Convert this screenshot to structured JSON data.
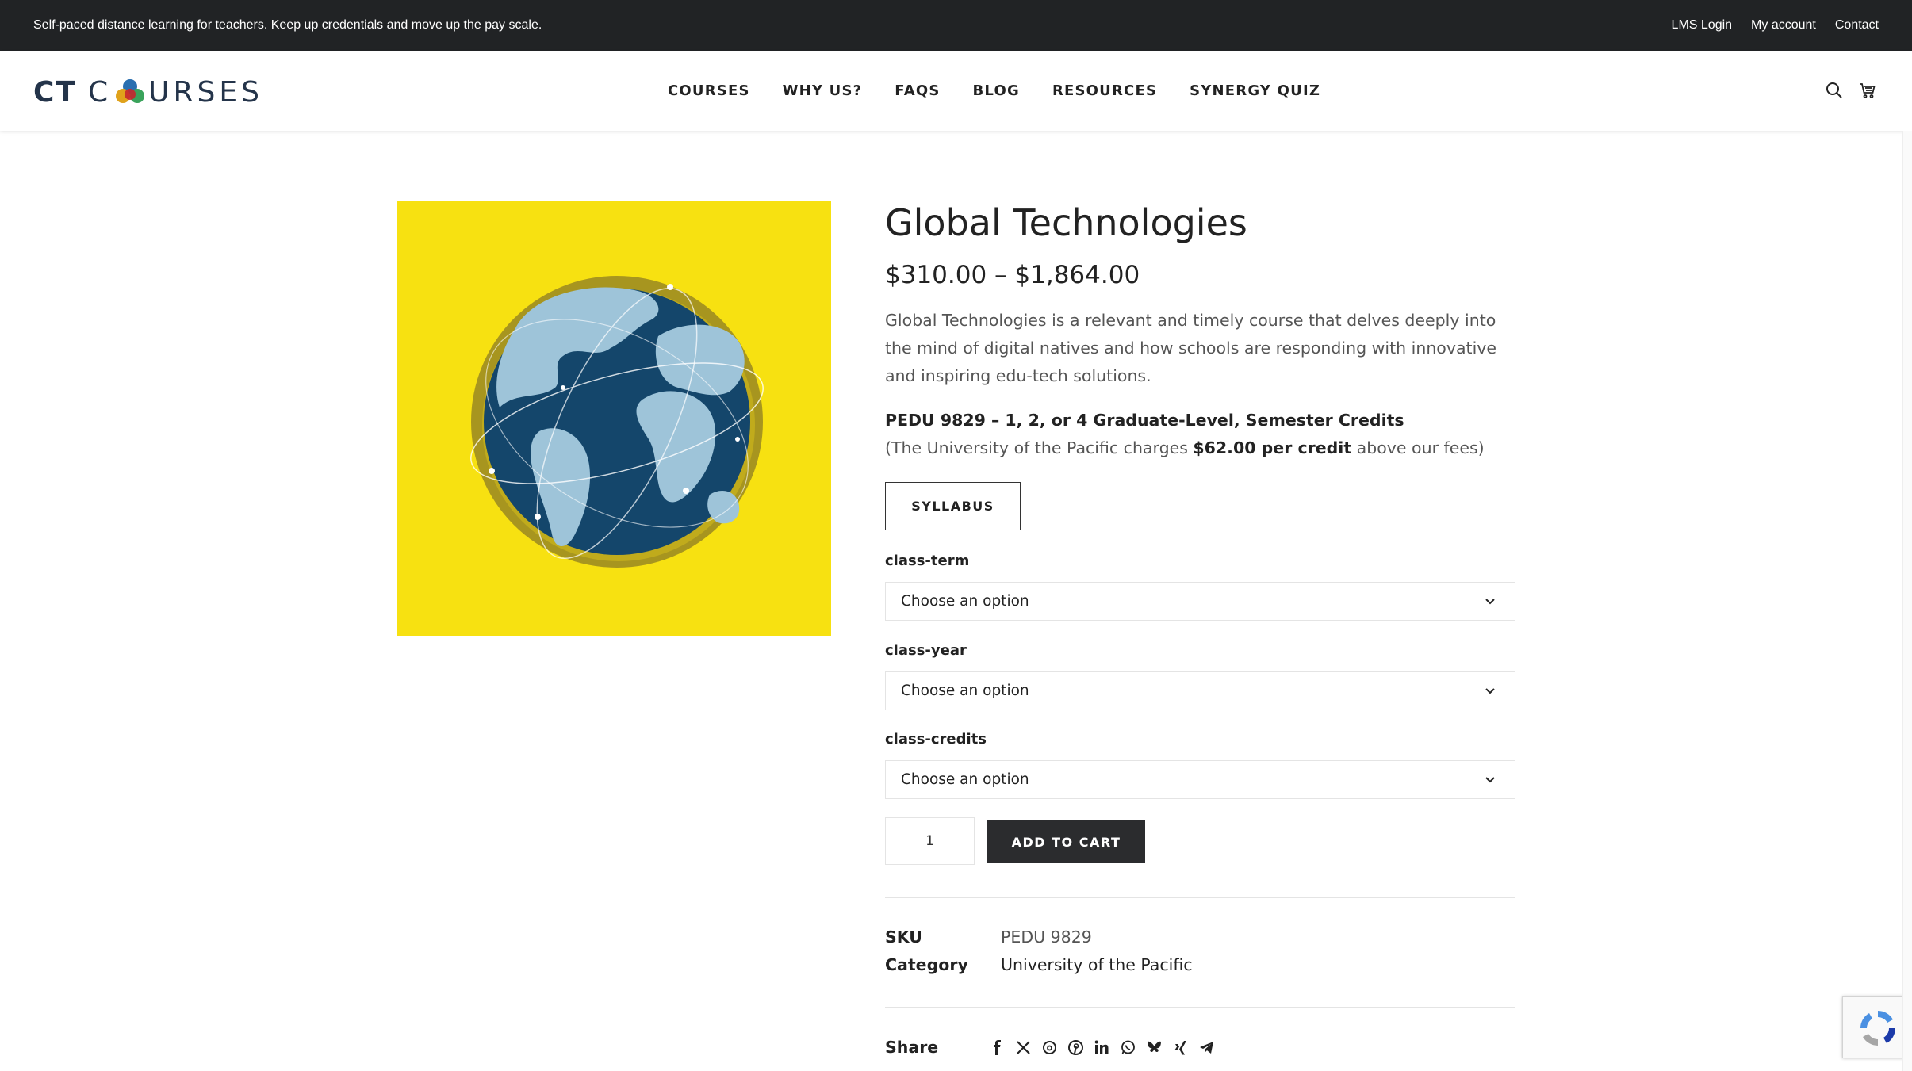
{
  "topbar": {
    "tagline": "Self-paced distance learning for teachers. Keep up credentials and move up the pay scale.",
    "links": [
      "LMS Login",
      "My account",
      "Contact"
    ]
  },
  "header": {
    "logo_ct": "CT",
    "logo_c": "C",
    "logo_rest": "URSES",
    "nav": [
      "COURSES",
      "WHY US?",
      "FAQS",
      "BLOG",
      "RESOURCES",
      "SYNERGY QUIZ"
    ],
    "icons": [
      "search-icon",
      "cart-icon"
    ]
  },
  "product": {
    "title": "Global Technologies",
    "price": "$310.00 – $1,864.00",
    "description": "Global Technologies is a relevant and timely course that delves deeply into the mind of digital natives and how schools are responding with innovative and inspiring edu-tech solutions.",
    "credits_line": "PEDU 9829 – 1, 2, or 4 Graduate-Level, Semester Credits",
    "fee_prefix": "(The University of the Pacific charges ",
    "fee_amount": "$62.00 per credit",
    "fee_suffix": " above our fees)",
    "syllabus_label": "SYLLABUS",
    "variations": [
      {
        "label": "class-term",
        "value": "Choose an option"
      },
      {
        "label": "class-year",
        "value": "Choose an option"
      },
      {
        "label": "class-credits",
        "value": "Choose an option"
      }
    ],
    "quantity": "1",
    "add_to_cart_label": "ADD TO CART",
    "meta": {
      "sku_label": "SKU",
      "sku_value": "PEDU 9829",
      "category_label": "Category",
      "category_value": "University of the Pacific"
    },
    "share_label": "Share",
    "share_icons": [
      "facebook-icon",
      "x-icon",
      "threads-icon",
      "pinterest-icon",
      "linkedin-icon",
      "whatsapp-icon",
      "bluesky-icon",
      "xing-icon",
      "telegram-icon"
    ]
  },
  "colors": {
    "topbar_bg": "#212325",
    "image_bg": "#f7e111",
    "globe_ocean": "#14466b",
    "globe_land": "#9ec4d9",
    "button_dark": "#2b2c2e"
  }
}
